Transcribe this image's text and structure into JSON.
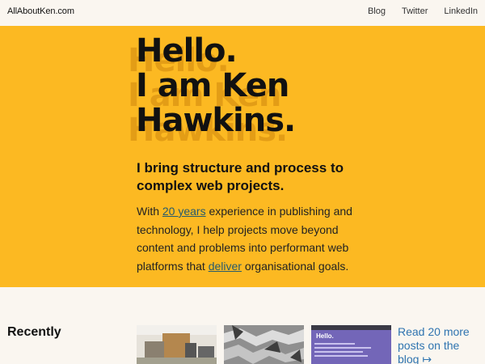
{
  "header": {
    "logo": "AllAboutKen.com",
    "nav": [
      "Blog",
      "Twitter",
      "LinkedIn"
    ]
  },
  "hero": {
    "title_lines": [
      "Hello.",
      "I am Ken",
      "Hawkins."
    ],
    "lead": "I bring structure and process to complex web projects.",
    "body_before_link1": "With ",
    "link1": "20 years",
    "body_middle": " experience in publishing and technology, I help projects move beyond content and problems into performant web platforms that ",
    "link2": "deliver",
    "body_after": " organisational goals."
  },
  "recent": {
    "heading": "Recently",
    "more_link": "Read 20 more posts on the blog ↦",
    "thumb3_title": "Hello."
  },
  "colors": {
    "hero_bg": "#fcb922",
    "page_bg": "#faf6f0",
    "link": "#2f74b0"
  }
}
